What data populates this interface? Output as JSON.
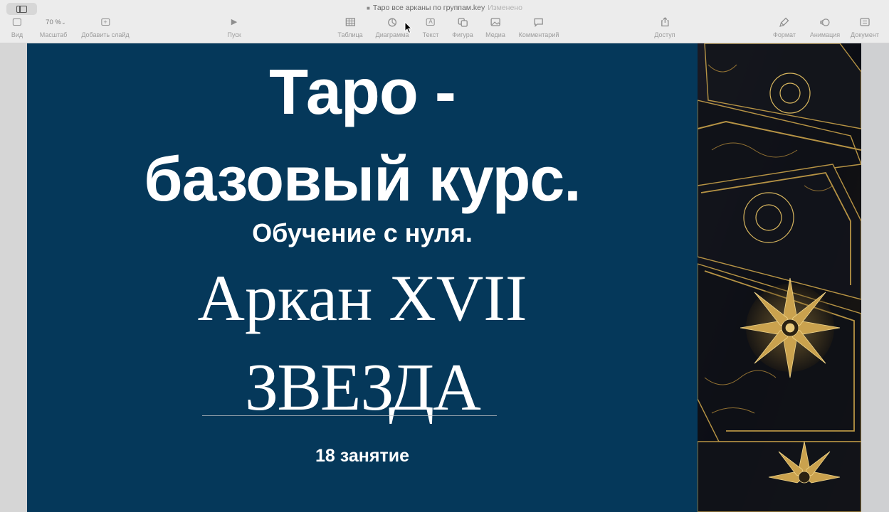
{
  "window": {
    "title": "Таро все арканы по группам.key",
    "edited_status": "Изменено"
  },
  "toolbar": {
    "view_label": "Вид",
    "zoom_value": "70 %",
    "zoom_label": "Масштаб",
    "add_slide_label": "Добавить слайд",
    "play_label": "Пуск",
    "table_label": "Таблица",
    "chart_label": "Диаграмма",
    "text_label": "Текст",
    "shape_label": "Фигура",
    "media_label": "Медиа",
    "comment_label": "Комментарий",
    "share_label": "Доступ",
    "format_label": "Формат",
    "animate_label": "Анимация",
    "document_label": "Документ"
  },
  "slide": {
    "title_line1": "Таро -",
    "title_line2": "базовый курс.",
    "subtitle": "Обучение с нуля.",
    "arcana": "Аркан XVII",
    "card_name": "ЗВЕЗДА",
    "lesson": "18 занятие"
  },
  "colors": {
    "slide_background": "#05385a",
    "text": "#ffffff",
    "art_gold": "#c9a24a"
  }
}
